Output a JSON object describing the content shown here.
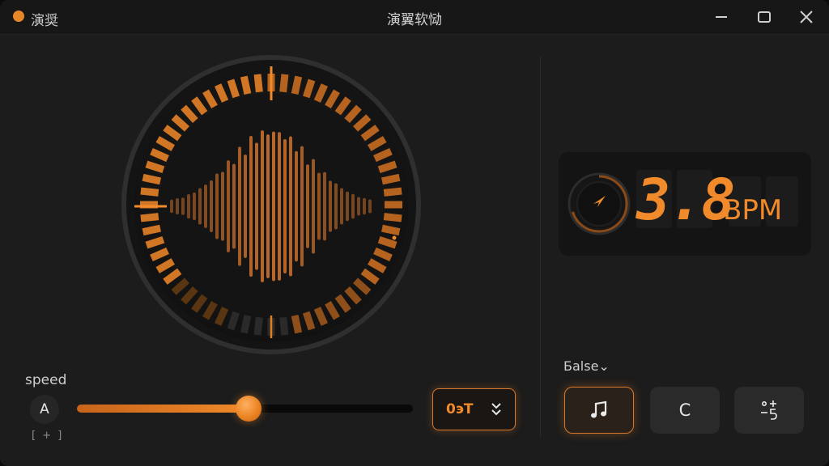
{
  "titlebar": {
    "app_name": "演奨",
    "window_title": "演翼软恸",
    "accent": "#e8862a",
    "controls": [
      "minimize-icon",
      "maximize-icon",
      "close-icon"
    ]
  },
  "tempo": {
    "value": "3.8",
    "unit": "BPM",
    "accent": "#f08a2a"
  },
  "speed": {
    "label": "speed",
    "button_label": "A",
    "sub_label": "[ + ]",
    "level_percent": 51
  },
  "dropdown": {
    "value": "0эT"
  },
  "mode": {
    "label": "Ƃalse⌄",
    "buttons": [
      {
        "icon": "music-note-icon",
        "active": true
      },
      {
        "icon": "c-letter-icon",
        "text": "C",
        "active": false
      },
      {
        "icon": "fraction-icon",
        "active": false
      }
    ]
  }
}
